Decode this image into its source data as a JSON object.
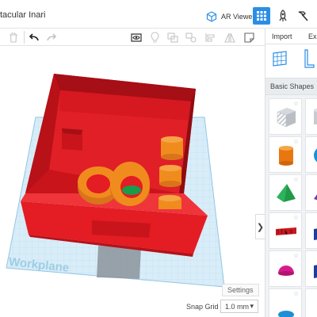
{
  "header": {
    "design_title": "tacular Inari",
    "ar_viewer_label": "AR Viewer"
  },
  "panel": {
    "tabs": [
      "Import",
      "Expo"
    ],
    "category": "Basic Shapes"
  },
  "workplane": {
    "label": "Workplane",
    "settings_label": "Settings",
    "snap_grid_label": "Snap Grid",
    "snap_grid_value": "1.0 mm"
  },
  "colors": {
    "accent": "#2b8ee6",
    "box_red": "#e0161d",
    "cylinder_orange": "#f08c1e",
    "grid_blue": "#cfe7f5"
  },
  "icons": [
    "ar-viewer-icon",
    "grid-view-icon",
    "rocket-icon",
    "hammer-icon",
    "trash-icon",
    "undo-icon",
    "redo-icon",
    "visibility-icon",
    "light-icon",
    "group-icon",
    "ungroup-icon",
    "align-icon",
    "mirror-icon",
    "note-icon"
  ]
}
